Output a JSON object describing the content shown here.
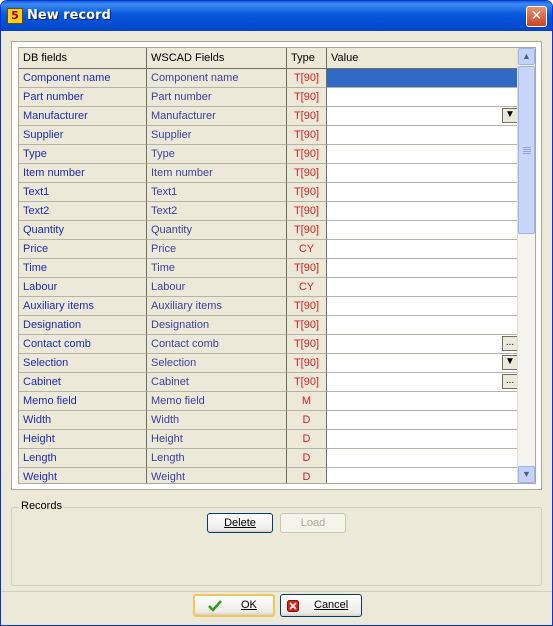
{
  "window": {
    "title": "New record",
    "icon_glyph": "5",
    "close_glyph": "✕"
  },
  "grid": {
    "columns": [
      "DB fields",
      "WSCAD Fields",
      "Type",
      "Value"
    ],
    "rows": [
      {
        "db": "Component name",
        "ws": "Component name",
        "type": "T[90]",
        "control": "",
        "selected": true
      },
      {
        "db": "Part number",
        "ws": "Part number",
        "type": "T[90]",
        "control": ""
      },
      {
        "db": "Manufacturer",
        "ws": "Manufacturer",
        "type": "T[90]",
        "control": "dropdown"
      },
      {
        "db": "Supplier",
        "ws": "Supplier",
        "type": "T[90]",
        "control": ""
      },
      {
        "db": "Type",
        "ws": "Type",
        "type": "T[90]",
        "control": ""
      },
      {
        "db": "Item number",
        "ws": "Item number",
        "type": "T[90]",
        "control": ""
      },
      {
        "db": "Text1",
        "ws": "Text1",
        "type": "T[90]",
        "control": ""
      },
      {
        "db": "Text2",
        "ws": "Text2",
        "type": "T[90]",
        "control": ""
      },
      {
        "db": "Quantity",
        "ws": "Quantity",
        "type": "T[90]",
        "control": ""
      },
      {
        "db": "Price",
        "ws": "Price",
        "type": "CY",
        "control": ""
      },
      {
        "db": "Time",
        "ws": "Time",
        "type": "T[90]",
        "control": ""
      },
      {
        "db": "Labour",
        "ws": "Labour",
        "type": "CY",
        "control": ""
      },
      {
        "db": "Auxiliary items",
        "ws": "Auxiliary items",
        "type": "T[90]",
        "control": ""
      },
      {
        "db": "Designation",
        "ws": "Designation",
        "type": "T[90]",
        "control": ""
      },
      {
        "db": "Contact comb",
        "ws": "Contact comb",
        "type": "T[90]",
        "control": "ellipsis"
      },
      {
        "db": "Selection",
        "ws": "Selection",
        "type": "T[90]",
        "control": "dropdown"
      },
      {
        "db": "Cabinet",
        "ws": "Cabinet",
        "type": "T[90]",
        "control": "ellipsis"
      },
      {
        "db": "Memo field",
        "ws": "Memo field",
        "type": "M",
        "control": ""
      },
      {
        "db": "Width",
        "ws": "Width",
        "type": "D",
        "control": ""
      },
      {
        "db": "Height",
        "ws": "Height",
        "type": "D",
        "control": ""
      },
      {
        "db": "Length",
        "ws": "Length",
        "type": "D",
        "control": ""
      },
      {
        "db": "Weight",
        "ws": "Weight",
        "type": "D",
        "control": ""
      }
    ],
    "dropdown_glyph": "▼",
    "ellipsis_glyph": "...",
    "scroll_up_glyph": "▲",
    "scroll_down_glyph": "▼"
  },
  "records": {
    "legend": "Records",
    "delete_label": "Delete",
    "load_label": "Load"
  },
  "footer": {
    "ok_label": "OK",
    "cancel_label": "Cancel",
    "ok_icon": "check-icon",
    "cancel_icon": "cancel-icon"
  },
  "colors": {
    "title_bar": "#0757dc",
    "selection": "#316ac5",
    "field_text": "#1d2cb0",
    "type_text": "#d02020",
    "dialog_bg": "#ece9d8"
  }
}
